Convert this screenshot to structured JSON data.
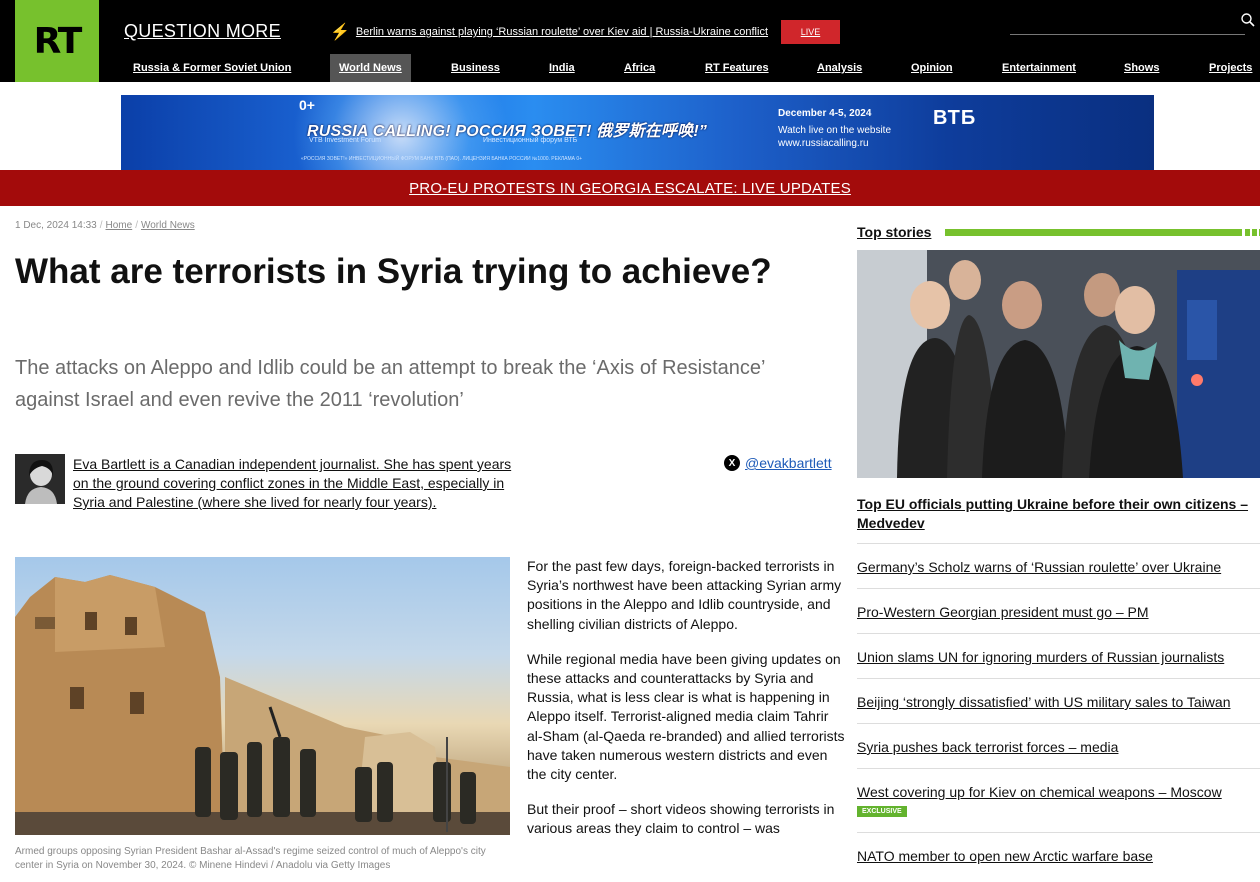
{
  "header": {
    "logo": "RT",
    "slogan": "QUESTION MORE",
    "breaking_news": "Berlin warns against playing ‘Russian roulette’ over Kiev aid | Russia-Ukraine conflict",
    "live_label": "LIVE",
    "nav": [
      {
        "label": "Russia & Former Soviet Union"
      },
      {
        "label": "World News"
      },
      {
        "label": "Business"
      },
      {
        "label": "India"
      },
      {
        "label": "Africa"
      },
      {
        "label": "RT Features"
      },
      {
        "label": "Analysis"
      },
      {
        "label": "Opinion"
      },
      {
        "label": "Entertainment"
      },
      {
        "label": "Shows"
      },
      {
        "label": "Projects"
      }
    ],
    "active_nav": "World News"
  },
  "banner": {
    "age": "0+",
    "title": "RUSSIA CALLING!  РОССИЯ ЗОВЕТ!  俄罗斯在呼唤!”",
    "sub_en": "VTB Investment Forum",
    "sub_ru": "Инвестиционный форум ВТБ",
    "fine_print": "«РОССИЯ ЗОВЕТ!» ИНВЕСТИЦИОННЫЙ ФОРУМ БАНК ВТБ (ПАО). ЛИЦЕНЗИЯ БАНКА РОССИИ №1000. РЕКЛАМА 0+",
    "date": "December 4-5, 2024",
    "watch": "Watch live on the website",
    "site": "www.russiacalling.ru",
    "brand": "ВТБ"
  },
  "red_strip": "PRO-EU PROTESTS IN GEORGIA ESCALATE: LIVE UPDATES",
  "article": {
    "timestamp": "1 Dec, 2024 14:33",
    "crumbs": [
      "Home",
      "World News"
    ],
    "headline": "What are terrorists in Syria trying to achieve?",
    "summary": "The attacks on Aleppo and Idlib could be an attempt to break the ‘Axis of Resistance’ against Israel and even revive the 2011 ‘revolution’",
    "author_bio": "Eva Bartlett is a Canadian independent journalist. She has spent years on the ground covering conflict zones in the Middle East, especially in Syria and Palestine (where she lived for nearly four years).",
    "x_handle": "@evakbartlett",
    "caption": "Armed groups opposing Syrian President Bashar al-Assad's regime seized control of much of Aleppo's city center in Syria on November 30, 2024. ©  Minene Hindevi / Anadolu via Getty Images",
    "paragraphs": [
      "For the past few days, foreign-backed terrorists in Syria’s northwest have been attacking Syrian army positions in the Aleppo and Idlib countryside, and shelling civilian districts of Aleppo.",
      "While regional media have been giving updates on these attacks and counterattacks by Syria and Russia, what is less clear is what is happening in Aleppo itself. Terrorist-aligned media claim Tahrir al-Sham (al-Qaeda re-branded) and allied terrorists have taken numerous western districts and even the city center.",
      "But their proof – short videos showing terrorists in various areas they claim to control – was"
    ]
  },
  "sidebar": {
    "heading": "Top stories",
    "main_story": "Top EU officials putting Ukraine before their own citizens – Medvedev",
    "stories": [
      {
        "title": "Germany’s Scholz warns of ‘Russian roulette’ over Ukraine"
      },
      {
        "title": "Pro-Western Georgian president must go – PM"
      },
      {
        "title": "Union slams UN for ignoring murders of Russian journalists"
      },
      {
        "title": "Beijing ‘strongly dissatisfied’ with US military sales to Taiwan"
      },
      {
        "title": "Syria pushes back terrorist forces – media"
      },
      {
        "title": "West covering up for Kiev on chemical weapons – Moscow",
        "badge": "EXCLUSIVE"
      },
      {
        "title": "NATO member to open new Arctic warfare base"
      }
    ]
  }
}
